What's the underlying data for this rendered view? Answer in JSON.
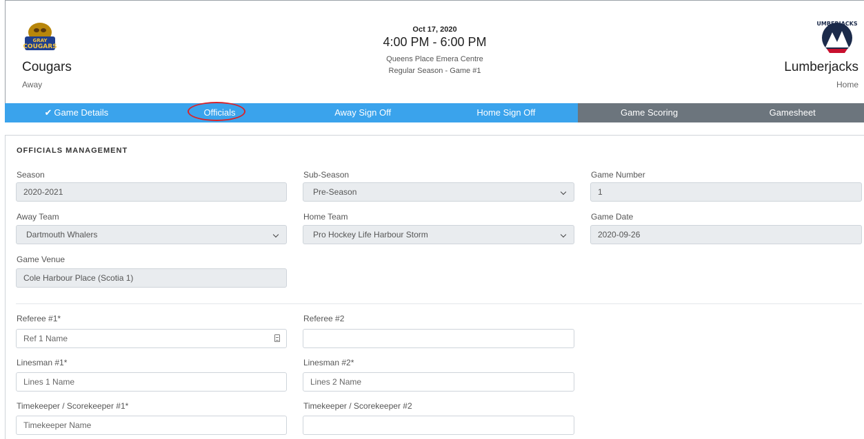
{
  "game": {
    "date": "Oct 17, 2020",
    "time": "4:00 PM - 6:00 PM",
    "venue": "Queens Place Emera Centre",
    "season_game": "Regular Season - Game #1"
  },
  "away": {
    "name": "Cougars",
    "role": "Away",
    "logo_text_top": "GRAY",
    "logo_text": "COUGARS"
  },
  "home": {
    "name": "Lumberjacks",
    "role": "Home",
    "logo_text": "UMBERJACKS"
  },
  "tabs": [
    {
      "label": "Game Details",
      "checked": true
    },
    {
      "label": "Officials"
    },
    {
      "label": "Away Sign Off"
    },
    {
      "label": "Home Sign Off"
    },
    {
      "label": "Game Scoring"
    },
    {
      "label": "Gamesheet"
    }
  ],
  "panel": {
    "title": "OFFICIALS MANAGEMENT",
    "season": {
      "label": "Season",
      "value": "2020-2021"
    },
    "sub_season": {
      "label": "Sub-Season",
      "value": "Pre-Season"
    },
    "game_number": {
      "label": "Game Number",
      "value": "1"
    },
    "away_team": {
      "label": "Away Team",
      "value": "Dartmouth Whalers"
    },
    "home_team": {
      "label": "Home Team",
      "value": "Pro Hockey Life Harbour Storm"
    },
    "game_date": {
      "label": "Game Date",
      "value": "2020-09-26"
    },
    "game_venue": {
      "label": "Game Venue",
      "value": "Cole Harbour Place (Scotia 1)"
    },
    "referee1": {
      "label": "Referee #1*",
      "placeholder": "Ref 1 Name",
      "value": ""
    },
    "referee2": {
      "label": "Referee #2",
      "placeholder": "",
      "value": ""
    },
    "linesman1": {
      "label": "Linesman #1*",
      "placeholder": "Lines 1 Name",
      "value": ""
    },
    "linesman2": {
      "label": "Linesman #2*",
      "placeholder": "Lines 2 Name",
      "value": ""
    },
    "timekeeper1": {
      "label": "Timekeeper / Scorekeeper #1*",
      "placeholder": "Timekeeper Name",
      "value": ""
    },
    "timekeeper2": {
      "label": "Timekeeper / Scorekeeper #2",
      "placeholder": "",
      "value": ""
    }
  },
  "colors": {
    "tab_blue": "#3aa3ec",
    "tab_gray": "#6c757d",
    "annotation_red": "#d8232a"
  }
}
